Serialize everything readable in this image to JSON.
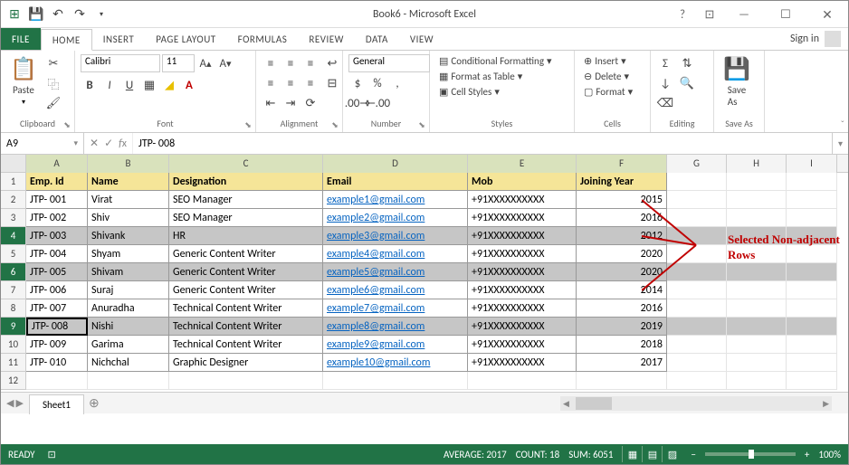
{
  "title": "Book6 - Microsoft Excel",
  "signin": "Sign in",
  "tabs": {
    "file": "FILE",
    "home": "HOME",
    "insert": "INSERT",
    "pagelayout": "PAGE LAYOUT",
    "formulas": "FORMULAS",
    "review": "REVIEW",
    "data": "DATA",
    "view": "VIEW"
  },
  "ribbon": {
    "clipboard": {
      "label": "Clipboard",
      "paste": "Paste"
    },
    "font": {
      "label": "Font",
      "name": "Calibri",
      "size": "11"
    },
    "alignment": {
      "label": "Alignment"
    },
    "number": {
      "label": "Number",
      "format": "General"
    },
    "styles": {
      "label": "Styles",
      "cond": "Conditional Formatting",
      "table": "Format as Table",
      "cell": "Cell Styles"
    },
    "cells": {
      "label": "Cells",
      "insert": "Insert",
      "delete": "Delete",
      "format": "Format"
    },
    "editing": {
      "label": "Editing"
    },
    "saveas": {
      "label": "Save As",
      "btn": "Save\nAs"
    }
  },
  "namebox": "A9",
  "formula": "JTP- 008",
  "columns": [
    "A",
    "B",
    "C",
    "D",
    "E",
    "F",
    "G",
    "H",
    "I"
  ],
  "selectedRows": [
    4,
    6,
    9
  ],
  "headers": {
    "a": "Emp. Id",
    "b": "Name",
    "c": "Designation",
    "d": "Email",
    "e": "Mob",
    "f": "Joining Year"
  },
  "rows": [
    {
      "n": 2,
      "a": "JTP- 001",
      "b": "Virat",
      "c": "SEO Manager",
      "d": "example1@gmail.com",
      "e": "+91XXXXXXXXXX",
      "f": "2015"
    },
    {
      "n": 3,
      "a": "JTP- 002",
      "b": "Shiv",
      "c": "SEO Manager",
      "d": "example2@gmail.com",
      "e": "+91XXXXXXXXXX",
      "f": "2016"
    },
    {
      "n": 4,
      "a": "JTP- 003",
      "b": "Shivank",
      "c": "HR",
      "d": "example3@gmail.com",
      "e": "+91XXXXXXXXXX",
      "f": "2012"
    },
    {
      "n": 5,
      "a": "JTP- 004",
      "b": "Shyam",
      "c": "Generic Content Writer",
      "d": "example4@gmail.com",
      "e": "+91XXXXXXXXXX",
      "f": "2020"
    },
    {
      "n": 6,
      "a": "JTP- 005",
      "b": "Shivam",
      "c": "Generic Content Writer",
      "d": "example5@gmail.com",
      "e": "+91XXXXXXXXXX",
      "f": "2020"
    },
    {
      "n": 7,
      "a": "JTP- 006",
      "b": "Suraj",
      "c": "Generic Content Writer",
      "d": "example6@gmail.com",
      "e": "+91XXXXXXXXXX",
      "f": "2014"
    },
    {
      "n": 8,
      "a": "JTP- 007",
      "b": "Anuradha",
      "c": "Technical Content Writer",
      "d": "example7@gmail.com",
      "e": "+91XXXXXXXXXX",
      "f": "2016"
    },
    {
      "n": 9,
      "a": "JTP- 008",
      "b": "Nishi",
      "c": "Technical Content Writer",
      "d": "example8@gmail.com",
      "e": "+91XXXXXXXXXX",
      "f": "2019"
    },
    {
      "n": 10,
      "a": "JTP- 009",
      "b": "Garima",
      "c": "Technical Content Writer",
      "d": "example9@gmail.com",
      "e": "+91XXXXXXXXXX",
      "f": "2018"
    },
    {
      "n": 11,
      "a": "JTP- 010",
      "b": "Nichchal",
      "c": "Graphic Designer",
      "d": "example10@gmail.com",
      "e": "+91XXXXXXXXXX",
      "f": "2017"
    }
  ],
  "annotation": "Selected Non-adjacent Rows",
  "sheet": "Sheet1",
  "status": {
    "ready": "READY",
    "avg": "AVERAGE: 2017",
    "count": "COUNT: 18",
    "sum": "SUM: 6051",
    "zoom": "100%"
  }
}
